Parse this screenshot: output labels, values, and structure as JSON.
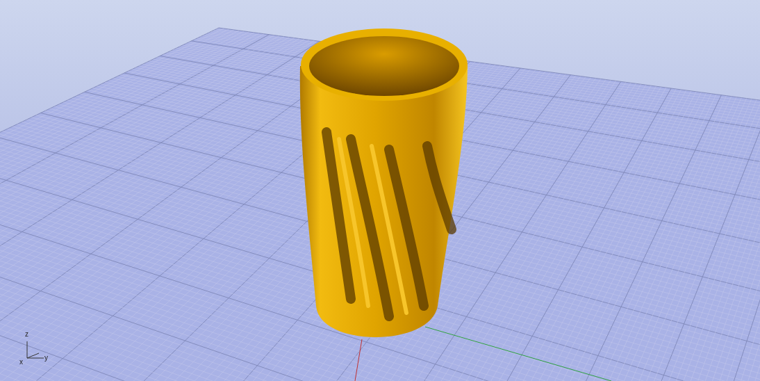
{
  "viewport": {
    "axis_widget": {
      "labels": [
        "z",
        "x",
        "y"
      ]
    }
  }
}
